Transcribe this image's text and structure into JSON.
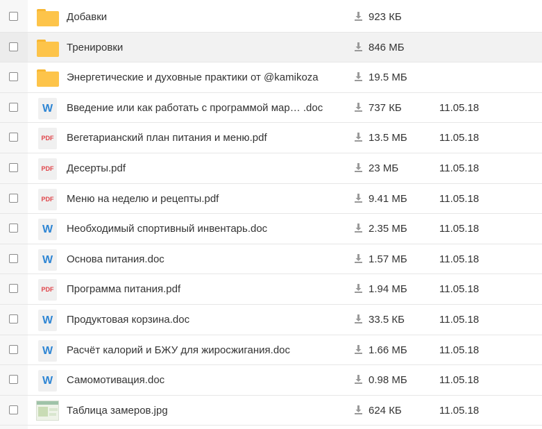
{
  "file_list": {
    "rows": [
      {
        "type": "folder",
        "name": "Добавки",
        "size": "923 КБ",
        "date": "",
        "icon": "folder-icon"
      },
      {
        "type": "folder",
        "name": "Тренировки",
        "size": "846 МБ",
        "date": "",
        "icon": "folder-icon"
      },
      {
        "type": "folder",
        "name": "Энергетические и духовные практики от @kamikoza",
        "size": "19.5 МБ",
        "date": "",
        "icon": "folder-icon"
      },
      {
        "type": "doc",
        "name": "Введение или как работать с программой мар… .doc",
        "size": "737 КБ",
        "date": "11.05.18",
        "icon": "word-doc-icon",
        "icon_text": "W"
      },
      {
        "type": "pdf",
        "name": "Вегетарианский план питания и меню.pdf",
        "size": "13.5 МБ",
        "date": "11.05.18",
        "icon": "pdf-icon",
        "icon_text": "PDF"
      },
      {
        "type": "pdf",
        "name": "Десерты.pdf",
        "size": "23 МБ",
        "date": "11.05.18",
        "icon": "pdf-icon",
        "icon_text": "PDF"
      },
      {
        "type": "pdf",
        "name": "Меню на неделю и рецепты.pdf",
        "size": "9.41 МБ",
        "date": "11.05.18",
        "icon": "pdf-icon",
        "icon_text": "PDF"
      },
      {
        "type": "doc",
        "name": "Необходимый спортивный инвентарь.doc",
        "size": "2.35 МБ",
        "date": "11.05.18",
        "icon": "word-doc-icon",
        "icon_text": "W"
      },
      {
        "type": "doc",
        "name": "Основа питания.doc",
        "size": "1.57 МБ",
        "date": "11.05.18",
        "icon": "word-doc-icon",
        "icon_text": "W"
      },
      {
        "type": "pdf",
        "name": "Программа питания.pdf",
        "size": "1.94 МБ",
        "date": "11.05.18",
        "icon": "pdf-icon",
        "icon_text": "PDF"
      },
      {
        "type": "doc",
        "name": "Продуктовая корзина.doc",
        "size": "33.5 КБ",
        "date": "11.05.18",
        "icon": "word-doc-icon",
        "icon_text": "W"
      },
      {
        "type": "doc",
        "name": "Расчёт калорий и БЖУ для жиросжигания.doc",
        "size": "1.66 МБ",
        "date": "11.05.18",
        "icon": "word-doc-icon",
        "icon_text": "W"
      },
      {
        "type": "doc",
        "name": "Самомотивация.doc",
        "size": "0.98 МБ",
        "date": "11.05.18",
        "icon": "word-doc-icon",
        "icon_text": "W"
      },
      {
        "type": "image",
        "name": "Таблица замеров.jpg",
        "size": "624 КБ",
        "date": "11.05.18",
        "icon": "image-thumbnail-icon"
      }
    ],
    "highlighted_row": 1
  },
  "colors": {
    "folder": "#fdc44a",
    "word": "#2f86d4",
    "pdf": "#e0454a",
    "text": "#333333",
    "download_icon": "#999999"
  }
}
